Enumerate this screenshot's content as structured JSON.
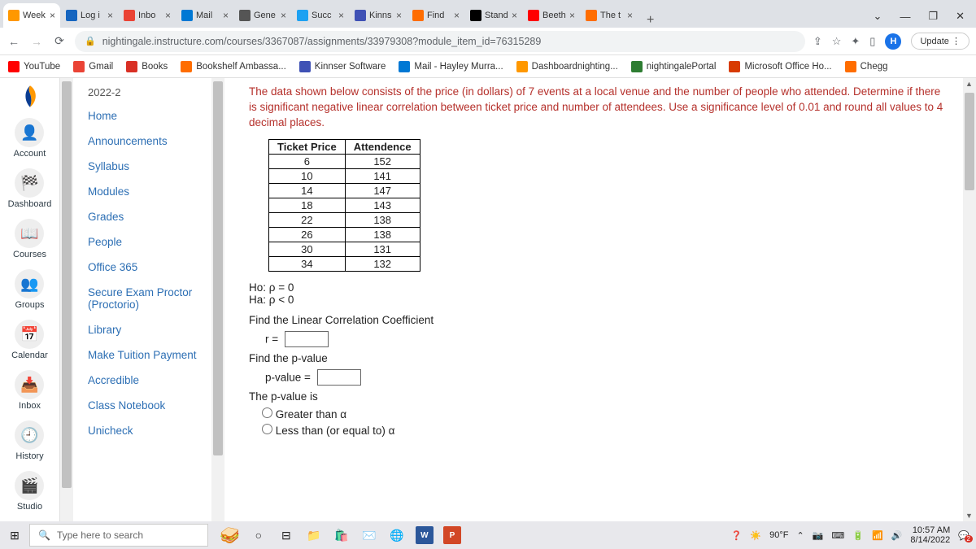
{
  "tabs": [
    {
      "label": "Week",
      "fav": "#ff9800"
    },
    {
      "label": "Log i",
      "fav": "#1565c0"
    },
    {
      "label": "Inbo",
      "fav": "#ea4335"
    },
    {
      "label": "Mail",
      "fav": "#0078d4"
    },
    {
      "label": "Gene",
      "fav": "#555"
    },
    {
      "label": "Succ",
      "fav": "#1da1f2"
    },
    {
      "label": "Kinns",
      "fav": "#3f51b5"
    },
    {
      "label": "Find",
      "fav": "#ff6d00"
    },
    {
      "label": "Stand",
      "fav": "#000"
    },
    {
      "label": "Beeth",
      "fav": "#ff0000"
    },
    {
      "label": "The t",
      "fav": "#ff6d00"
    }
  ],
  "url": "nightingale.instructure.com/courses/3367087/assignments/33979308?module_item_id=76315289",
  "update": "Update",
  "bookmarks": [
    {
      "label": "YouTube",
      "fav": "#ff0000"
    },
    {
      "label": "Gmail",
      "fav": "#ea4335"
    },
    {
      "label": "Books",
      "fav": "#d93025"
    },
    {
      "label": "Bookshelf Ambassa...",
      "fav": "#ff6d00"
    },
    {
      "label": "Kinnser Software",
      "fav": "#3f51b5"
    },
    {
      "label": "Mail - Hayley Murra...",
      "fav": "#0078d4"
    },
    {
      "label": "Dashboardnighting...",
      "fav": "#ff9800"
    },
    {
      "label": "nightingalePortal",
      "fav": "#2e7d32"
    },
    {
      "label": "Microsoft Office Ho...",
      "fav": "#d83b01"
    },
    {
      "label": "Chegg",
      "fav": "#ff6d00"
    }
  ],
  "global_nav": [
    "Account",
    "Dashboard",
    "Courses",
    "Groups",
    "Calendar",
    "Inbox",
    "History",
    "Studio"
  ],
  "course_nav": {
    "term": "2022-2",
    "items": [
      "Home",
      "Announcements",
      "Syllabus",
      "Modules",
      "Grades",
      "People",
      "Office 365",
      "Secure Exam Proctor (Proctorio)",
      "Library",
      "Make Tuition Payment",
      "Accredible",
      "Class Notebook",
      "Unicheck"
    ]
  },
  "content": {
    "prompt": "The data shown below consists of the price (in dollars) of 7 events at a local venue and the number of people who attended. Determine if there is significant negative linear correlation between ticket price and number of attendees. Use a significance level of 0.01 and round all values to 4 decimal places.",
    "th1": "Ticket Price",
    "th2": "Attendence",
    "h0": "Ho: ρ = 0",
    "ha": "Ha: ρ < 0",
    "find_r": "Find the Linear Correlation Coefficient",
    "r_lbl": "r =",
    "find_p": "Find the p-value",
    "p_lbl": "p-value =",
    "p_is": "The p-value is",
    "opt1": "Greater than α",
    "opt2": "Less than (or equal to) α"
  },
  "chart_data": {
    "type": "table",
    "columns": [
      "Ticket Price",
      "Attendence"
    ],
    "rows": [
      [
        6,
        152
      ],
      [
        10,
        141
      ],
      [
        14,
        147
      ],
      [
        18,
        143
      ],
      [
        22,
        138
      ],
      [
        26,
        138
      ],
      [
        30,
        131
      ],
      [
        34,
        132
      ]
    ]
  },
  "taskbar": {
    "search": "Type here to search",
    "temp": "90°F",
    "time": "10:57 AM",
    "date": "8/14/2022"
  }
}
